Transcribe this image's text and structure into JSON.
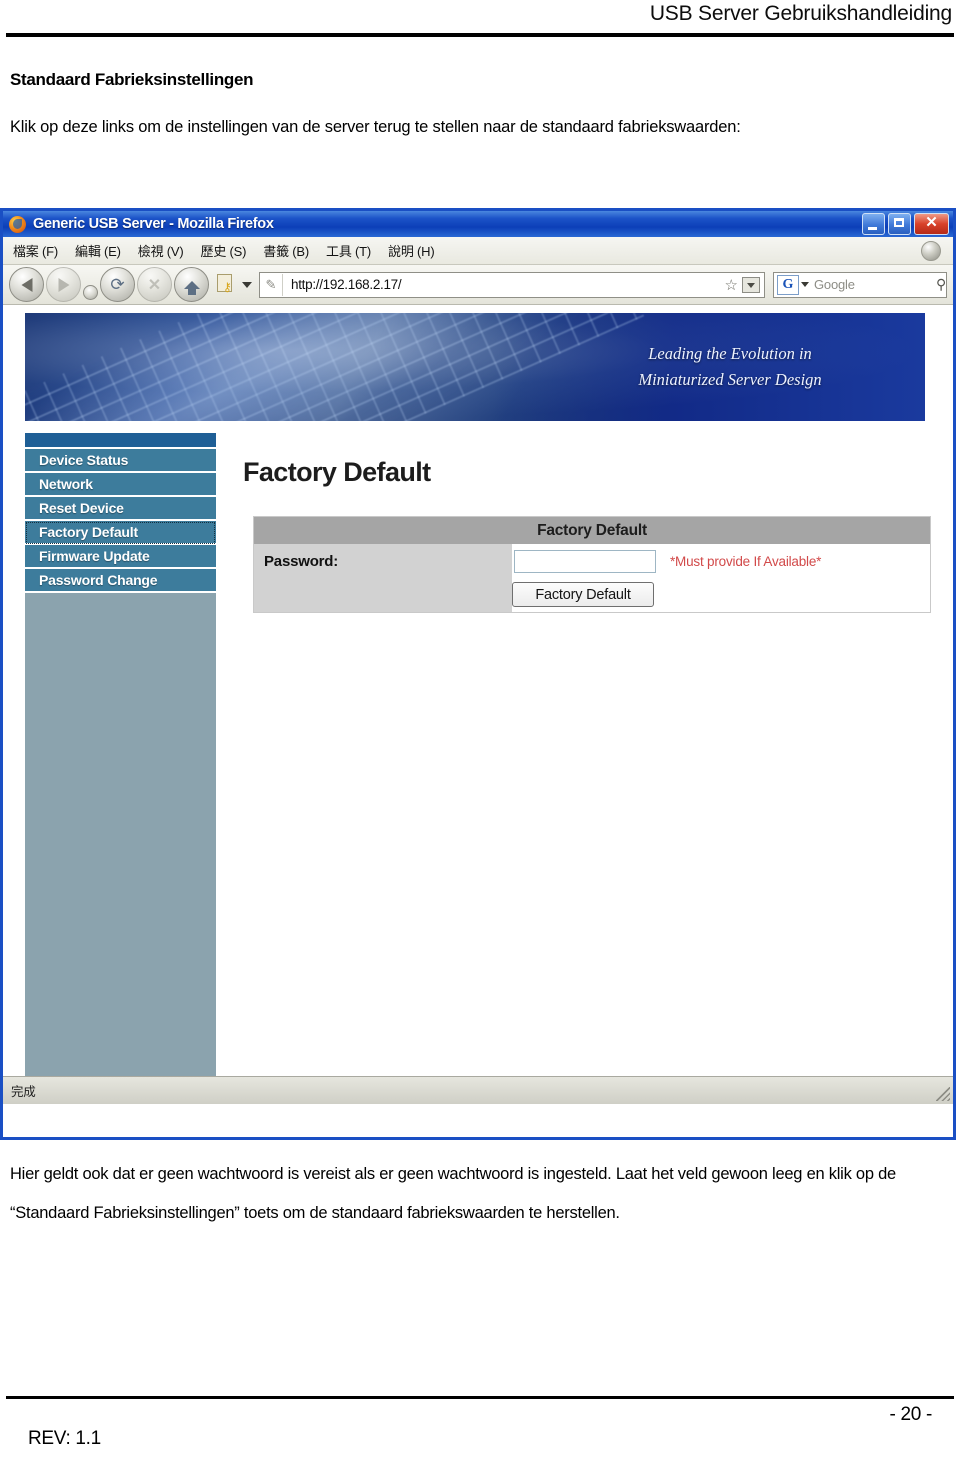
{
  "document": {
    "header_title": "USB Server Gebruikshandleiding",
    "section_title": "Standaard Fabrieksinstellingen",
    "intro_paragraph": "Klik op deze links om de instellingen van de server terug te stellen naar de standaard fabriekswaarden:",
    "outro_paragraph": "Hier geldt ook dat er geen wachtwoord is vereist als er geen wachtwoord is ingesteld. Laat het veld gewoon leeg en klik op de “Standaard Fabrieksinstellingen” toets om de standaard fabriekswaarden te herstellen.",
    "page_number": "- 20 -",
    "revision": "REV: 1.1"
  },
  "browser": {
    "title": "Generic USB Server - Mozilla Firefox",
    "window_controls": {
      "minimize": "–",
      "maximize": "□",
      "close": "✕"
    },
    "menu": [
      "檔案 (F)",
      "編輯 (E)",
      "檢視 (V)",
      "歷史 (S)",
      "書籤 (B)",
      "工具 (T)",
      "說明 (H)"
    ],
    "toolbar": {
      "back": "back-arrow",
      "forward": "forward-arrow",
      "reload": "⟳",
      "stop": "✕",
      "home": "home-glyph",
      "bookmark_key": "⚷"
    },
    "url": "http://192.168.2.17/",
    "url_favicon": "✎",
    "url_star": "☆",
    "search": {
      "engine_letter": "G",
      "placeholder": "Google",
      "magnifier": "⚲"
    },
    "status": "完成"
  },
  "page": {
    "banner_line1": "Leading the Evolution in",
    "banner_line2": "Miniaturized Server Design",
    "sidebar": [
      {
        "label": "Device Status",
        "focused": false
      },
      {
        "label": "Network",
        "focused": false
      },
      {
        "label": "Reset Device",
        "focused": false
      },
      {
        "label": "Factory Default",
        "focused": true
      },
      {
        "label": "Firmware Update",
        "focused": false
      },
      {
        "label": "Password Change",
        "focused": false
      }
    ],
    "heading": "Factory Default",
    "table": {
      "header": "Factory Default",
      "password_label": "Password:",
      "password_value": "",
      "password_hint": "*Must provide If Available*",
      "submit_label": "Factory Default"
    }
  }
}
